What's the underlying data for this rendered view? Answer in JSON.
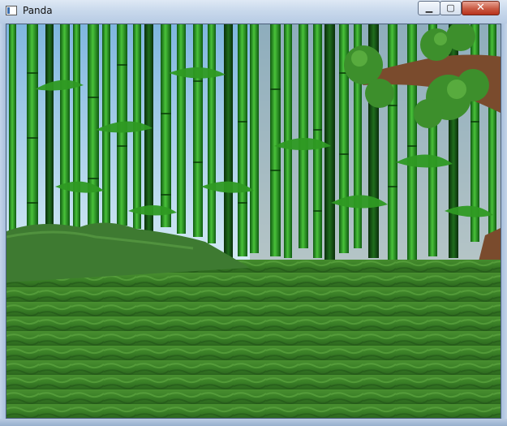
{
  "window": {
    "title": "Panda"
  },
  "controls": {
    "minimize": "▁",
    "maximize": "▢",
    "close": "✕"
  },
  "colors": {
    "sky": "#8fc3e6",
    "bamboo": "#2e9b20",
    "grass": "#3f8a2a",
    "rock": "#3e7a31",
    "trunk": "#7a4b2d"
  }
}
